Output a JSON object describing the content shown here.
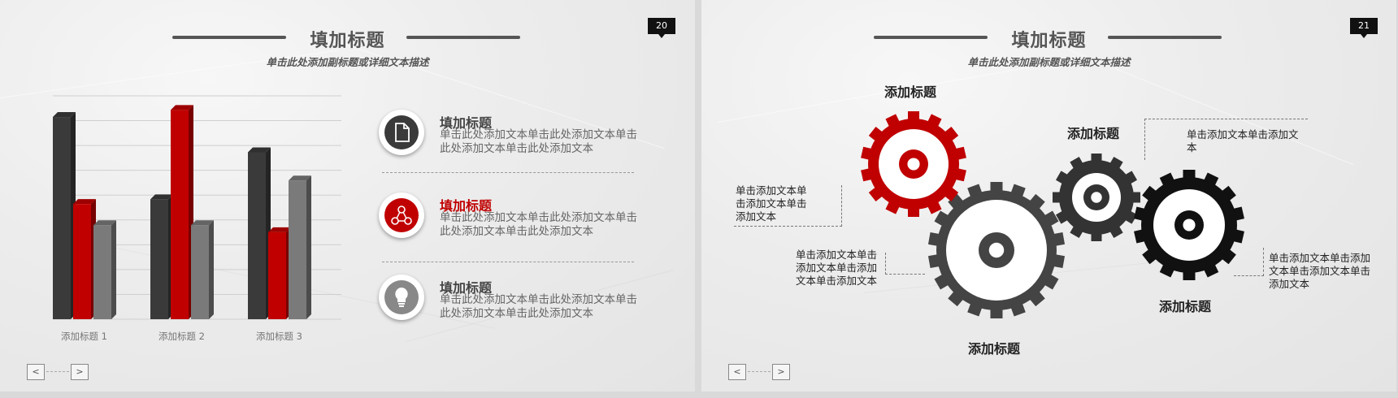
{
  "slides": [
    {
      "title": "填加标题",
      "subtitle": "单击此处添加副标题或详细文本描述",
      "page_number": "20",
      "nav": {
        "prev": "<",
        "next": ">"
      },
      "items": [
        {
          "title": "填加标题",
          "text": "单击此处添加文本单击此处添加文本单击此处添加文本单击此处添加文本",
          "icon": "document-icon",
          "accent": "#3a3a3a"
        },
        {
          "title": "填加标题",
          "text": "单击此处添加文本单击此处添加文本单击此处添加文本单击此处添加文本",
          "icon": "network-icon",
          "accent": "#c00000"
        },
        {
          "title": "填加标题",
          "text": "单击此处添加文本单击此处添加文本单击此处添加文本单击此处添加文本",
          "icon": "lightbulb-icon",
          "accent": "#888888"
        }
      ],
      "colors": {
        "dark": "#3a3a3a",
        "red": "#c00000",
        "gray": "#7a7a7a"
      }
    },
    {
      "title": "填加标题",
      "subtitle": "单击此处添加副标题或详细文本描述",
      "page_number": "21",
      "nav": {
        "prev": "<",
        "next": ">"
      },
      "gear_titles": [
        "添加标题",
        "添加标题",
        "添加标题",
        "添加标题"
      ],
      "gear_texts": [
        "单击添加文本单击添加文本单击添加文本",
        "单击添加文本单击添加文本单击添加文本单击添加文本",
        "单击添加文本单击添加文本",
        "单击添加文本单击添加文本单击添加文本单击添加文本"
      ]
    }
  ],
  "chart_data": {
    "type": "bar",
    "categories": [
      "添加标题 1",
      "添加标题 2",
      "添加标题 3"
    ],
    "series": [
      {
        "values": [
          86,
          51,
          71
        ],
        "color": "#3a3a3a"
      },
      {
        "values": [
          49,
          89,
          37
        ],
        "color": "#c00000"
      },
      {
        "values": [
          40,
          40,
          59
        ],
        "color": "#7a7a7a"
      }
    ],
    "ylim": [
      0,
      95
    ],
    "grid": true
  }
}
